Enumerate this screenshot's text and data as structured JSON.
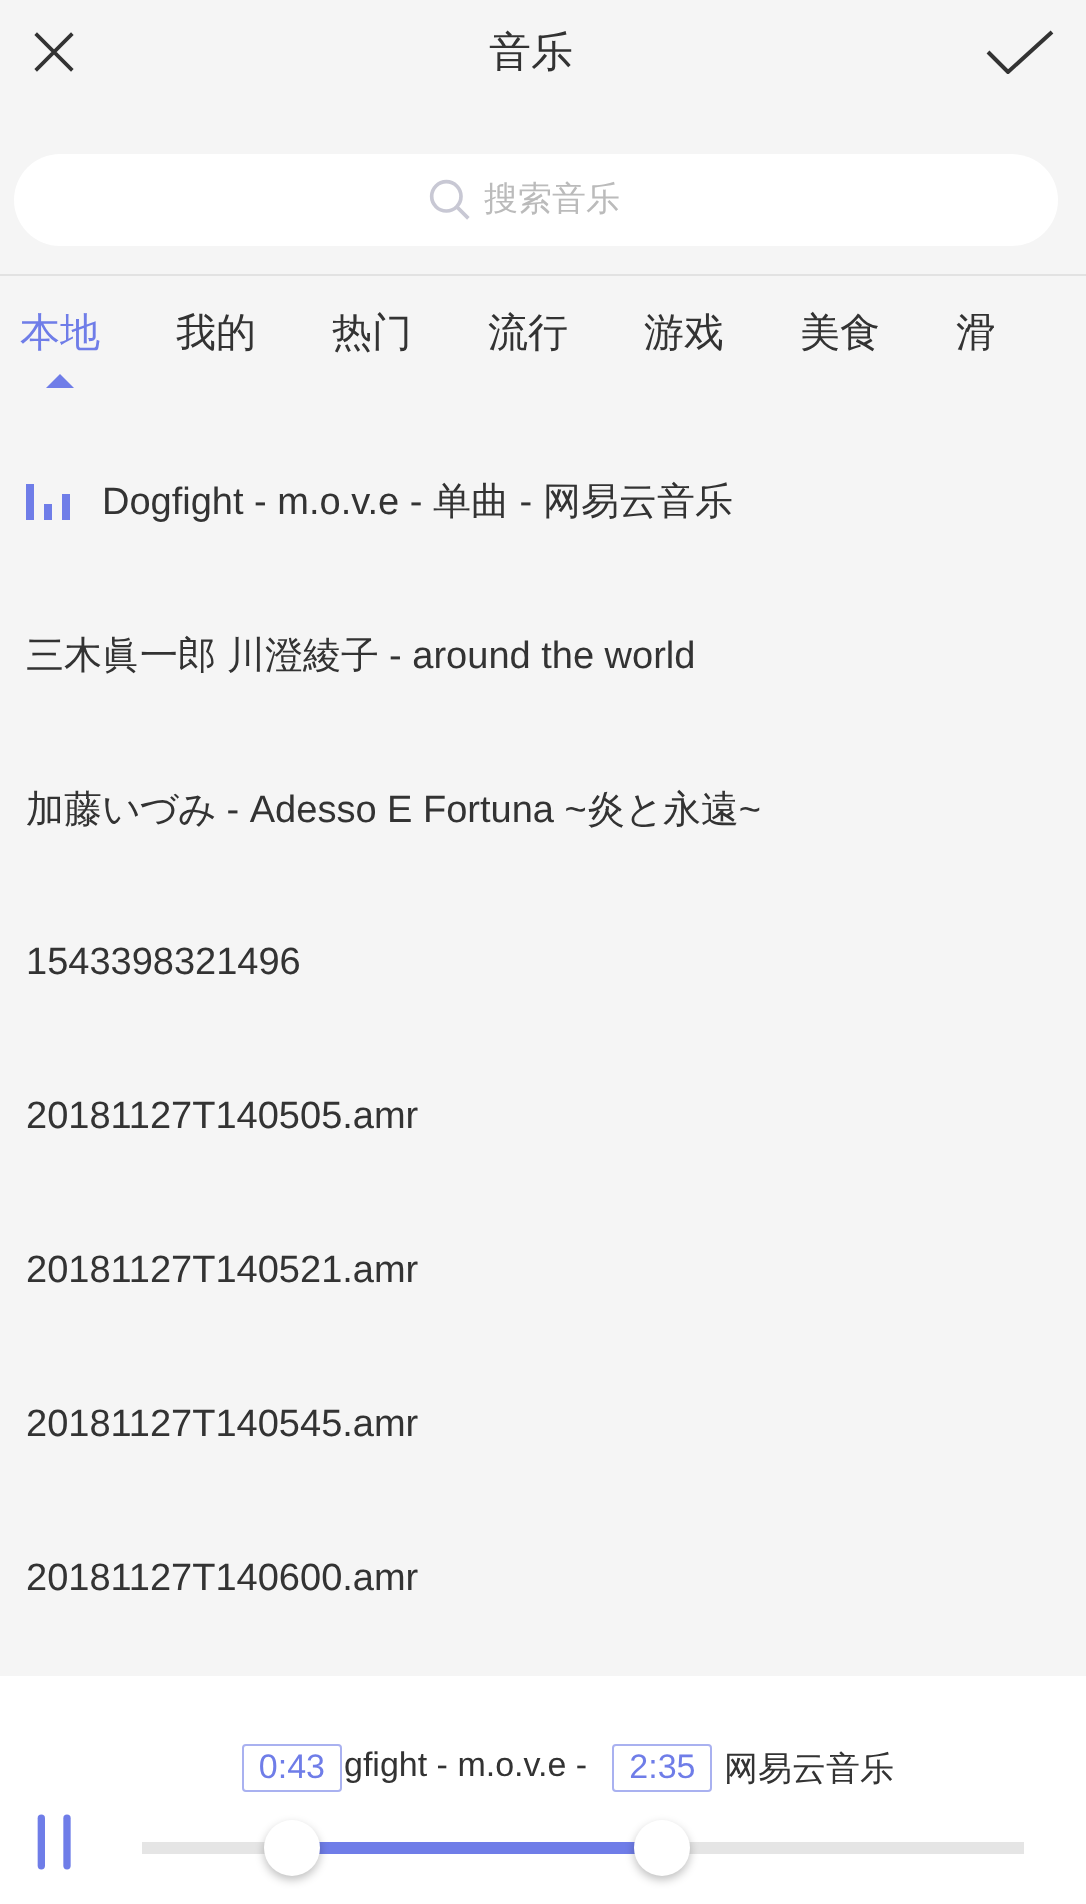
{
  "header": {
    "title": "音乐"
  },
  "search": {
    "placeholder": "搜索音乐"
  },
  "tabs": [
    {
      "label": "本地",
      "selected": true
    },
    {
      "label": "我的",
      "selected": false
    },
    {
      "label": "热门",
      "selected": false
    },
    {
      "label": "流行",
      "selected": false
    },
    {
      "label": "游戏",
      "selected": false
    },
    {
      "label": "美食",
      "selected": false
    },
    {
      "label": "滑",
      "selected": false
    }
  ],
  "songs": [
    {
      "title": "Dogfight - m.o.v.e - 单曲 - 网易云音乐",
      "playing": true
    },
    {
      "title": "三木眞一郎 川澄綾子 - around the world",
      "playing": false
    },
    {
      "title": "加藤いづみ - Adesso E Fortuna ~炎と永遠~",
      "playing": false
    },
    {
      "title": "1543398321496",
      "playing": false
    },
    {
      "title": "20181127T140505.amr",
      "playing": false
    },
    {
      "title": "20181127T140521.amr",
      "playing": false
    },
    {
      "title": "20181127T140545.amr",
      "playing": false
    },
    {
      "title": "20181127T140600.amr",
      "playing": false
    }
  ],
  "player": {
    "now_playing": [
      "gfight - m.o.v.e -",
      "网易云音乐"
    ],
    "paused": false,
    "thumbs": [
      {
        "level": 0.17,
        "time": "0:43"
      },
      {
        "level": 0.59,
        "time": "2:35"
      }
    ]
  }
}
